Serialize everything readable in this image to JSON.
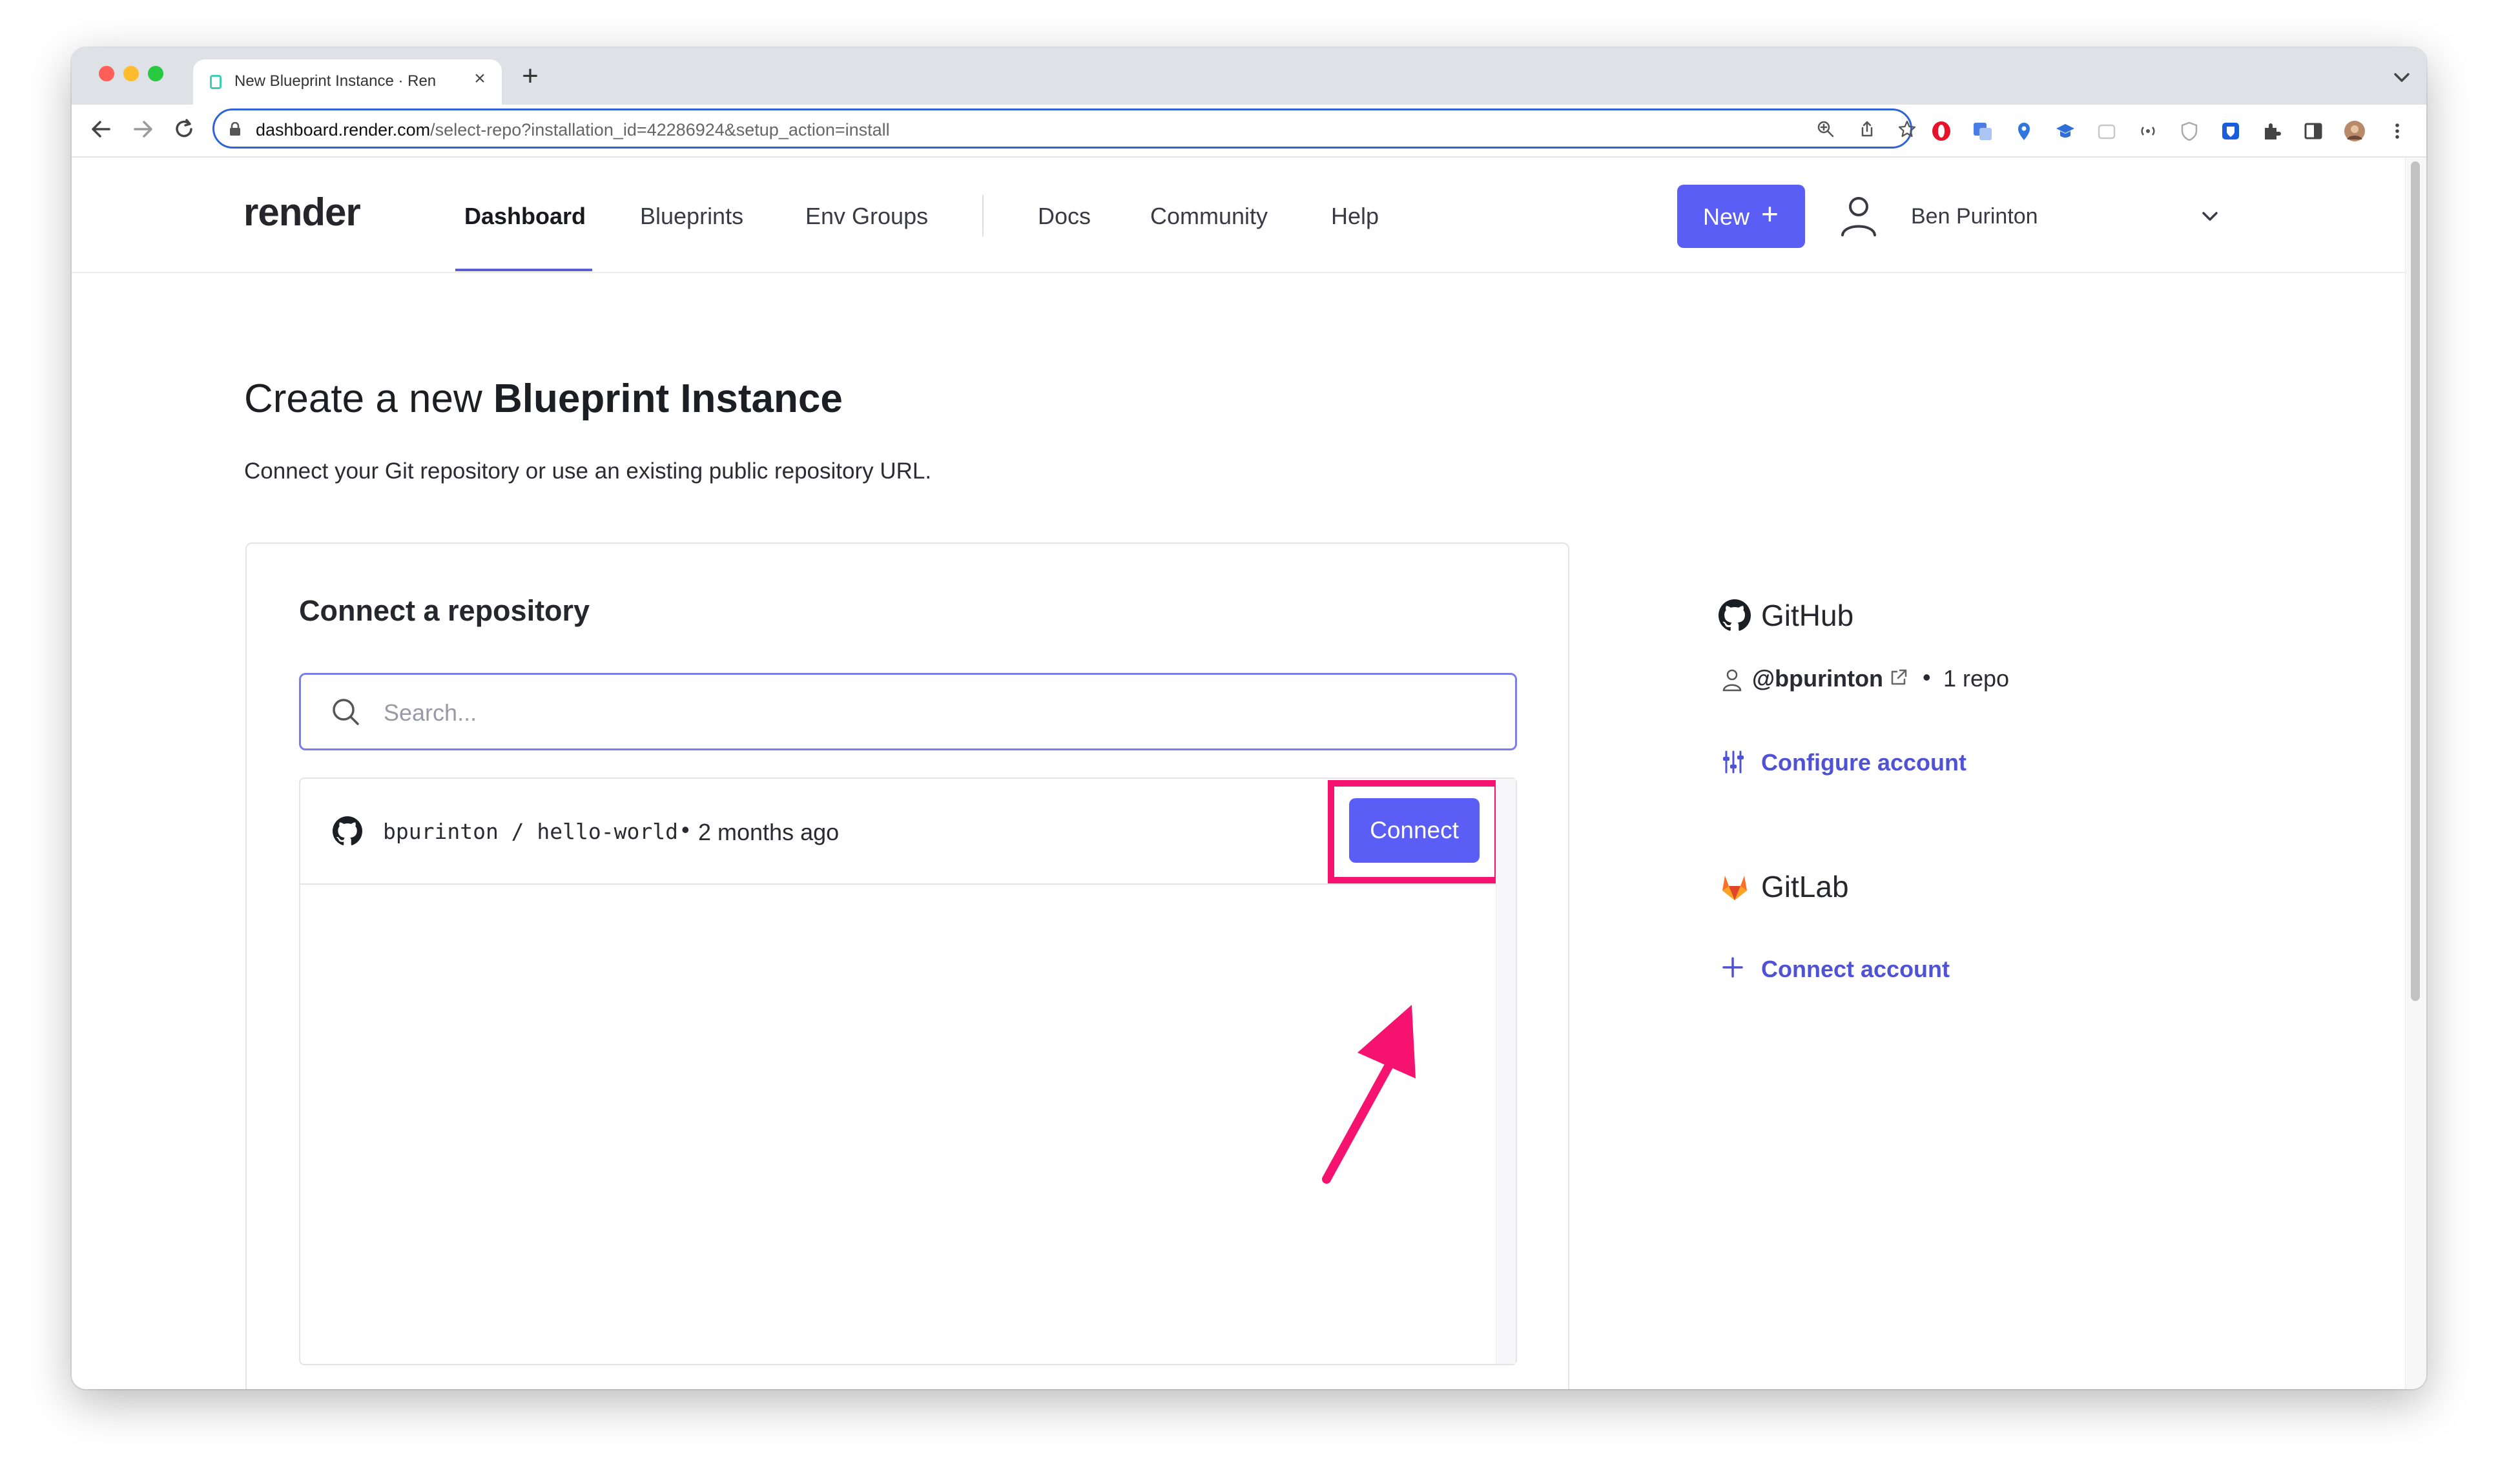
{
  "browser": {
    "tab_title": "New Blueprint Instance · Ren",
    "tab_close": "×",
    "new_tab": "+",
    "url_domain": "dashboard.render.com",
    "url_path": "/select-repo?installation_id=42286924&setup_action=install"
  },
  "app_nav": {
    "logo": "render",
    "links": [
      "Dashboard",
      "Blueprints",
      "Env Groups",
      "Docs",
      "Community",
      "Help"
    ],
    "new_button": "New",
    "new_plus": "+",
    "user_name": "Ben Purinton"
  },
  "page": {
    "title_prefix": "Create a new",
    "title_bold": "Blueprint Instance",
    "subtitle": "Connect your Git repository or use an existing public repository URL."
  },
  "repo_card": {
    "title": "Connect a repository",
    "search_placeholder": "Search...",
    "repos": [
      {
        "name": "bpurinton / hello-world",
        "separator": "•",
        "updated": "2 months ago",
        "action": "Connect"
      }
    ]
  },
  "github": {
    "heading": "GitHub",
    "username": "@bpurinton",
    "separator": "•",
    "repo_count": "1 repo",
    "configure_link": "Configure account"
  },
  "gitlab": {
    "heading": "GitLab",
    "connect_link": "Connect account"
  },
  "colors": {
    "brand_purple": "#5a5ef5",
    "link_purple": "#4f52d4",
    "highlight_pink": "#f5136f",
    "gitlab_orange": "#e24329"
  }
}
